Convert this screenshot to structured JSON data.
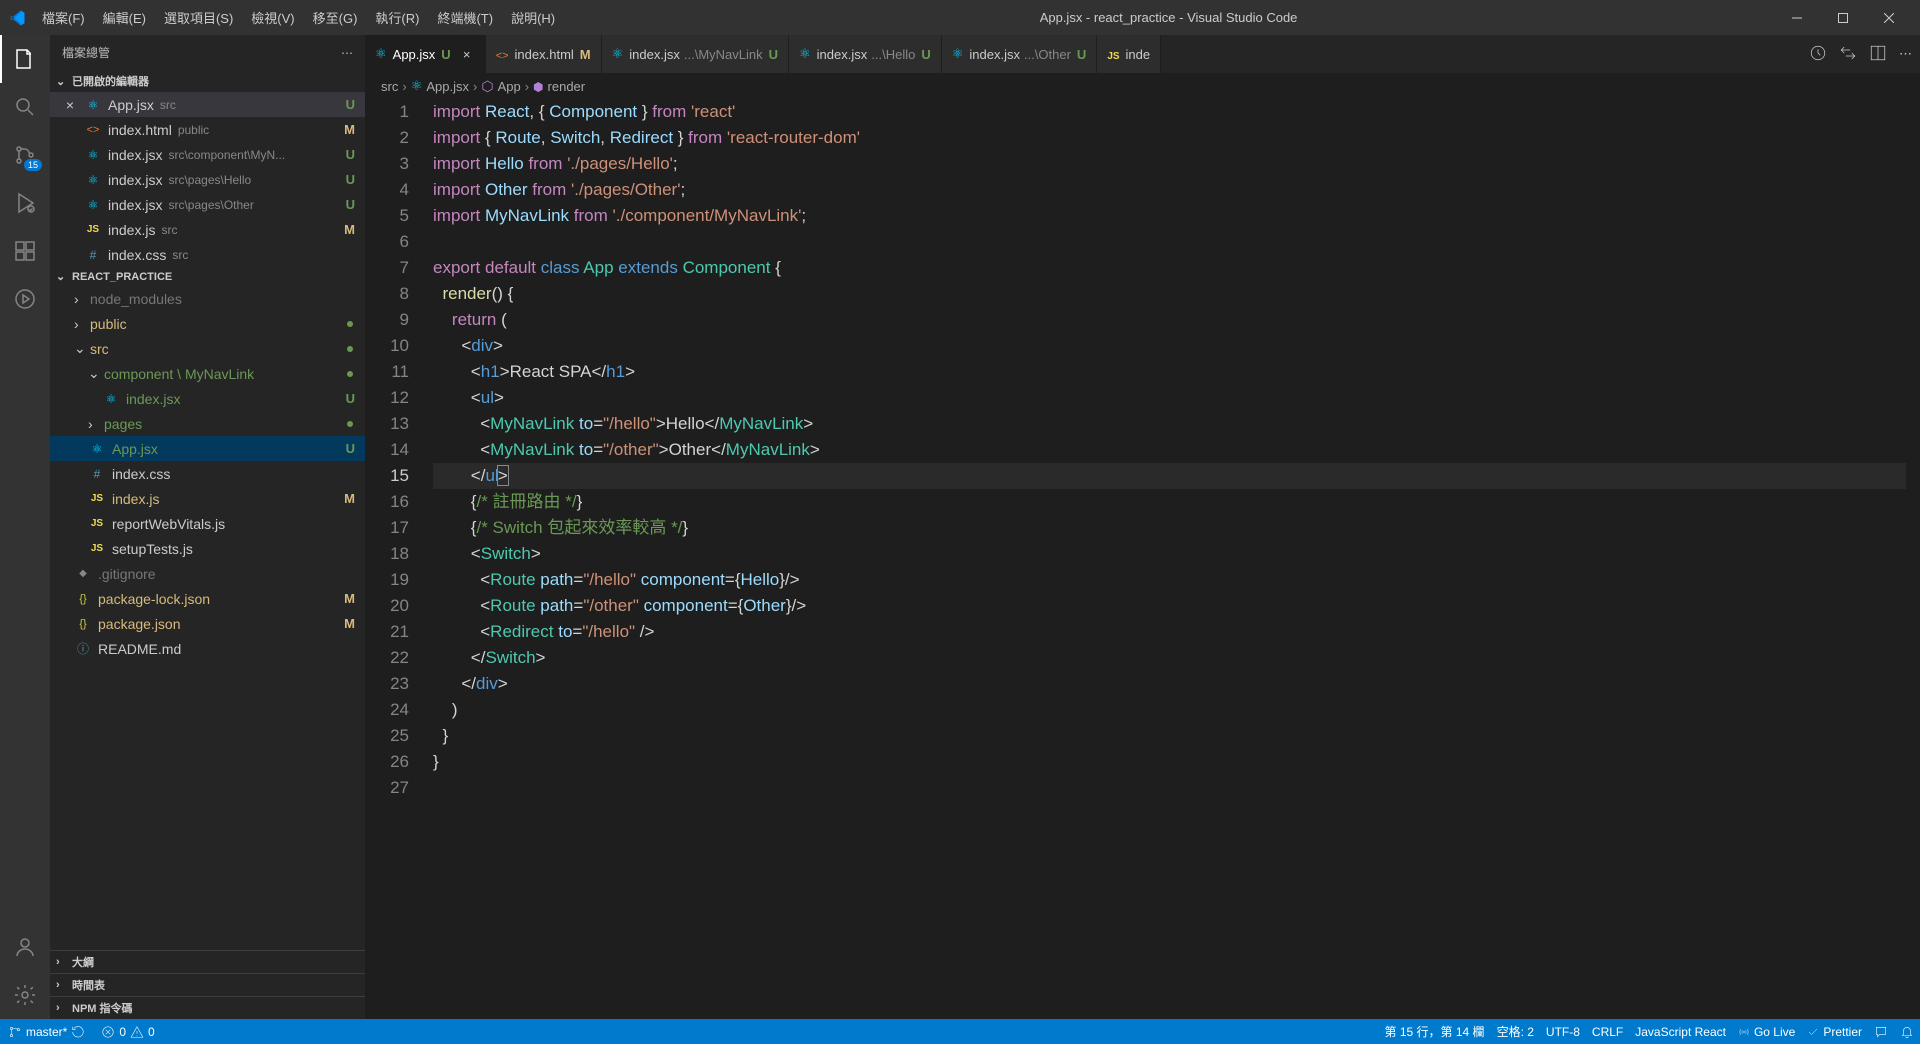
{
  "titlebar": {
    "menu": [
      "檔案(F)",
      "編輯(E)",
      "選取項目(S)",
      "檢視(V)",
      "移至(G)",
      "執行(R)",
      "終端機(T)",
      "說明(H)"
    ],
    "title": "App.jsx - react_practice - Visual Studio Code"
  },
  "activitybar": {
    "scm_badge": "15"
  },
  "sidebar": {
    "title": "檔案總管",
    "open_editors_label": "已開啟的編輯器",
    "open_editors": [
      {
        "icon": "react",
        "name": "App.jsx",
        "path": "src",
        "badge": "U",
        "selected": true
      },
      {
        "icon": "html",
        "name": "index.html",
        "path": "public",
        "badge": "M"
      },
      {
        "icon": "react",
        "name": "index.jsx",
        "path": "src\\component\\MyN...",
        "badge": "U"
      },
      {
        "icon": "react",
        "name": "index.jsx",
        "path": "src\\pages\\Hello",
        "badge": "U"
      },
      {
        "icon": "react",
        "name": "index.jsx",
        "path": "src\\pages\\Other",
        "badge": "U"
      },
      {
        "icon": "js",
        "name": "index.js",
        "path": "src",
        "badge": "M"
      },
      {
        "icon": "css",
        "name": "index.css",
        "path": "src"
      }
    ],
    "project": "REACT_PRACTICE",
    "tree": [
      {
        "indent": 0,
        "chev": "right",
        "name": "node_modules",
        "type": "folder",
        "class": "git-ignore"
      },
      {
        "indent": 0,
        "chev": "right",
        "name": "public",
        "type": "folder",
        "dot": true,
        "class": "git-mod"
      },
      {
        "indent": 0,
        "chev": "down",
        "name": "src",
        "type": "folder",
        "dot": true,
        "class": "git-mod"
      },
      {
        "indent": 1,
        "chev": "down",
        "name": "component \\ MyNavLink",
        "type": "folder",
        "dot": true,
        "class": "git-new"
      },
      {
        "indent": 2,
        "icon": "react",
        "name": "index.jsx",
        "badge": "U",
        "class": "git-new"
      },
      {
        "indent": 1,
        "chev": "right",
        "name": "pages",
        "type": "folder",
        "dot": true,
        "class": "git-new"
      },
      {
        "indent": 1,
        "icon": "react",
        "name": "App.jsx",
        "badge": "U",
        "class": "git-new",
        "current": true
      },
      {
        "indent": 1,
        "icon": "css",
        "name": "index.css"
      },
      {
        "indent": 1,
        "icon": "js",
        "name": "index.js",
        "badge": "M",
        "class": "git-mod"
      },
      {
        "indent": 1,
        "icon": "js",
        "name": "reportWebVitals.js"
      },
      {
        "indent": 1,
        "icon": "js",
        "name": "setupTests.js"
      },
      {
        "indent": 0,
        "icon": "git",
        "name": ".gitignore",
        "class": "git-ignore"
      },
      {
        "indent": 0,
        "icon": "json",
        "name": "package-lock.json",
        "badge": "M",
        "class": "git-mod"
      },
      {
        "indent": 0,
        "icon": "json",
        "name": "package.json",
        "badge": "M",
        "class": "git-mod"
      },
      {
        "indent": 0,
        "icon": "info",
        "name": "README.md"
      }
    ],
    "sections": [
      "大綱",
      "時間表",
      "NPM 指令碼"
    ]
  },
  "tabs": [
    {
      "icon": "react",
      "label": "App.jsx",
      "stat": "U",
      "active": true,
      "close": true
    },
    {
      "icon": "html",
      "label": "index.html",
      "stat": "M"
    },
    {
      "icon": "react",
      "label": "index.jsx",
      "sub": "...\\MyNavLink",
      "stat": "U"
    },
    {
      "icon": "react",
      "label": "index.jsx",
      "sub": "...\\Hello",
      "stat": "U"
    },
    {
      "icon": "react",
      "label": "index.jsx",
      "sub": "...\\Other",
      "stat": "U"
    },
    {
      "icon": "js",
      "label": "inde"
    }
  ],
  "breadcrumbs": [
    {
      "text": "src"
    },
    {
      "icon": "react",
      "text": "App.jsx"
    },
    {
      "icon": "symbol",
      "text": "App"
    },
    {
      "icon": "method",
      "text": "render"
    }
  ],
  "code": {
    "lines": [
      {
        "n": 1,
        "html": "<span class='c-keyi'>import</span> <span class='c-var'>React</span><span class='c-punc'>, { </span><span class='c-var'>Component</span><span class='c-punc'> } </span><span class='c-keyi'>from</span> <span class='c-str'>'react'</span>"
      },
      {
        "n": 2,
        "html": "<span class='c-keyi'>import</span> <span class='c-punc'>{ </span><span class='c-var'>Route</span><span class='c-punc'>, </span><span class='c-var'>Switch</span><span class='c-punc'>, </span><span class='c-var'>Redirect</span><span class='c-punc'> } </span><span class='c-keyi'>from</span> <span class='c-str'>'react-router-dom'</span>"
      },
      {
        "n": 3,
        "html": "<span class='c-keyi'>import</span> <span class='c-var'>Hello</span> <span class='c-keyi'>from</span> <span class='c-str'>'./pages/Hello'</span><span class='c-punc'>;</span>"
      },
      {
        "n": 4,
        "html": "<span class='c-keyi'>import</span> <span class='c-var'>Other</span> <span class='c-keyi'>from</span> <span class='c-str'>'./pages/Other'</span><span class='c-punc'>;</span>"
      },
      {
        "n": 5,
        "html": "<span class='c-keyi'>import</span> <span class='c-var'>MyNavLink</span> <span class='c-keyi'>from</span> <span class='c-str'>'./component/MyNavLink'</span><span class='c-punc'>;</span>"
      },
      {
        "n": 6,
        "html": ""
      },
      {
        "n": 7,
        "html": "<span class='c-keyi'>export</span> <span class='c-keyi'>default</span> <span class='c-kw'>class</span> <span class='c-type'>App</span> <span class='c-kw'>extends</span> <span class='c-type'>Component</span> <span class='c-punc'>{</span>"
      },
      {
        "n": 8,
        "html": "  <span class='c-fn'>render</span><span class='c-punc'>() {</span>"
      },
      {
        "n": 9,
        "html": "    <span class='c-keyi'>return</span> <span class='c-punc'>(</span>"
      },
      {
        "n": 10,
        "html": "      <span class='c-punc'>&lt;</span><span class='c-kw'>div</span><span class='c-punc'>&gt;</span>"
      },
      {
        "n": 11,
        "html": "        <span class='c-punc'>&lt;</span><span class='c-kw'>h1</span><span class='c-punc'>&gt;</span><span class='c-txt'>React SPA</span><span class='c-punc'>&lt;/</span><span class='c-kw'>h1</span><span class='c-punc'>&gt;</span>"
      },
      {
        "n": 12,
        "html": "        <span class='c-punc'>&lt;</span><span class='c-kw'>ul</span><span class='c-punc'>&gt;</span>"
      },
      {
        "n": 13,
        "html": "          <span class='c-punc'>&lt;</span><span class='c-tag'>MyNavLink</span> <span class='c-attr'>to</span><span class='c-punc'>=</span><span class='c-str'>\"/hello\"</span><span class='c-punc'>&gt;</span><span class='c-txt'>Hello</span><span class='c-punc'>&lt;/</span><span class='c-tag'>MyNavLink</span><span class='c-punc'>&gt;</span>"
      },
      {
        "n": 14,
        "html": "          <span class='c-punc'>&lt;</span><span class='c-tag'>MyNavLink</span> <span class='c-attr'>to</span><span class='c-punc'>=</span><span class='c-str'>\"/other\"</span><span class='c-punc'>&gt;</span><span class='c-txt'>Other</span><span class='c-punc'>&lt;/</span><span class='c-tag'>MyNavLink</span><span class='c-punc'>&gt;</span>"
      },
      {
        "n": 15,
        "html": "        <span class='c-punc'>&lt;/</span><span class='c-kw'>ul</span><span class='cursor-box c-punc'>&gt;</span>",
        "active": true
      },
      {
        "n": 16,
        "html": "        <span class='c-punc'>{</span><span class='c-cmt'>/* 註冊路由 */</span><span class='c-punc'>}</span>"
      },
      {
        "n": 17,
        "html": "        <span class='c-punc'>{</span><span class='c-cmt'>/* Switch 包起來效率較高 */</span><span class='c-punc'>}</span>"
      },
      {
        "n": 18,
        "html": "        <span class='c-punc'>&lt;</span><span class='c-tag'>Switch</span><span class='c-punc'>&gt;</span>"
      },
      {
        "n": 19,
        "html": "          <span class='c-punc'>&lt;</span><span class='c-tag'>Route</span> <span class='c-attr'>path</span><span class='c-punc'>=</span><span class='c-str'>\"/hello\"</span> <span class='c-attr'>component</span><span class='c-punc'>={</span><span class='c-var'>Hello</span><span class='c-punc'>}/&gt;</span>"
      },
      {
        "n": 20,
        "html": "          <span class='c-punc'>&lt;</span><span class='c-tag'>Route</span> <span class='c-attr'>path</span><span class='c-punc'>=</span><span class='c-str'>\"/other\"</span> <span class='c-attr'>component</span><span class='c-punc'>={</span><span class='c-var'>Other</span><span class='c-punc'>}/&gt;</span>"
      },
      {
        "n": 21,
        "html": "          <span class='c-punc'>&lt;</span><span class='c-tag'>Redirect</span> <span class='c-attr'>to</span><span class='c-punc'>=</span><span class='c-str'>\"/hello\"</span> <span class='c-punc'>/&gt;</span>"
      },
      {
        "n": 22,
        "html": "        <span class='c-punc'>&lt;/</span><span class='c-tag'>Switch</span><span class='c-punc'>&gt;</span>"
      },
      {
        "n": 23,
        "html": "      <span class='c-punc'>&lt;/</span><span class='c-kw'>div</span><span class='c-punc'>&gt;</span>"
      },
      {
        "n": 24,
        "html": "    <span class='c-punc'>)</span>"
      },
      {
        "n": 25,
        "html": "  <span class='c-punc'>}</span>"
      },
      {
        "n": 26,
        "html": "<span class='c-punc'>}</span>"
      },
      {
        "n": 27,
        "html": ""
      }
    ]
  },
  "statusbar": {
    "branch": "master*",
    "errors": "0",
    "warnings": "0",
    "position": "第 15 行，第 14 欄",
    "spaces": "空格: 2",
    "encoding": "UTF-8",
    "eol": "CRLF",
    "language": "JavaScript React",
    "golive": "Go Live",
    "prettier": "Prettier"
  }
}
